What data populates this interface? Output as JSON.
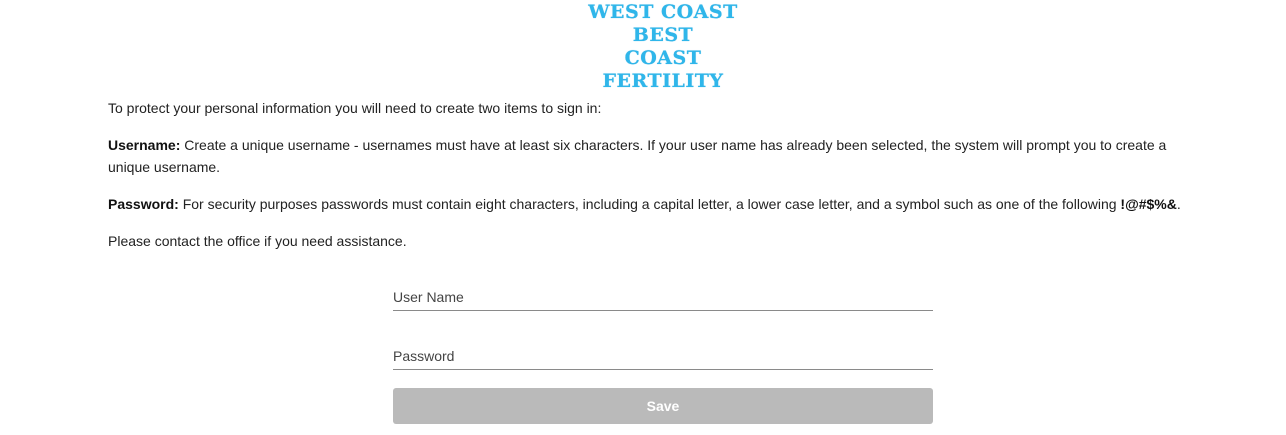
{
  "logo": {
    "line1": "WEST COAST BEST",
    "line2": "COAST FERTILITY"
  },
  "intro": {
    "line1": "To protect your personal information you will need to create two items to sign in:",
    "username_label": "Username:",
    "username_text": " Create a unique username - usernames must have at least six characters. If your user name has already been selected, the system will prompt you to create a unique username.",
    "password_label": "Password:",
    "password_text": " For security purposes passwords must contain eight characters, including a capital letter, a lower case letter, and a symbol such as one of the following ",
    "password_symbols": "!@#$%&",
    "password_end": ".",
    "contact": "Please contact the office if you need assistance."
  },
  "form": {
    "username_placeholder": "User Name",
    "password_placeholder": "Password",
    "save_label": "Save"
  },
  "colors": {
    "logo": "#2fb6ea",
    "button_disabled": "#bababa"
  }
}
